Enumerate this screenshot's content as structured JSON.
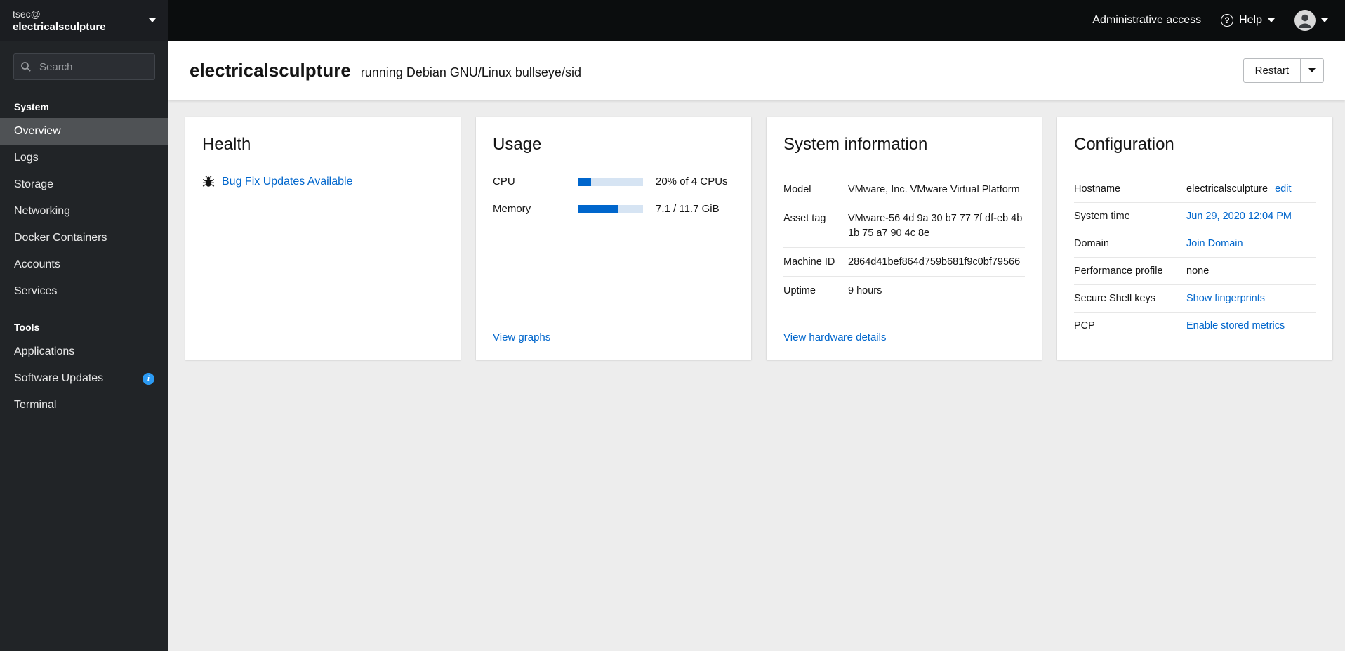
{
  "icons": {
    "help": "?",
    "info": "i"
  },
  "colors": {
    "accent": "#0066cc",
    "selected_nav": "#4f5255",
    "progress_track": "#d6e4f3",
    "info_badge": "#2b9af3"
  },
  "sidebar": {
    "host_user": "tsec@",
    "host_name": "electricalsculpture",
    "search_placeholder": "Search",
    "sections": [
      {
        "label": "System",
        "items": [
          {
            "label": "Overview"
          },
          {
            "label": "Logs"
          },
          {
            "label": "Storage"
          },
          {
            "label": "Networking"
          },
          {
            "label": "Docker Containers"
          },
          {
            "label": "Accounts"
          },
          {
            "label": "Services"
          }
        ]
      },
      {
        "label": "Tools",
        "items": [
          {
            "label": "Applications"
          },
          {
            "label": "Software Updates"
          },
          {
            "label": "Terminal"
          }
        ]
      }
    ]
  },
  "topbar": {
    "admin_access": "Administrative access",
    "help": "Help"
  },
  "header": {
    "hostname": "electricalsculpture",
    "os": "running Debian GNU/Linux bullseye/sid",
    "restart_label": "Restart"
  },
  "cards": {
    "health": {
      "title": "Health",
      "update_link": "Bug Fix Updates Available"
    },
    "usage": {
      "title": "Usage",
      "rows": [
        {
          "label": "CPU",
          "percent": 20,
          "value": "20% of 4 CPUs"
        },
        {
          "label": "Memory",
          "percent": 61,
          "value": "7.1 / 11.7 GiB"
        }
      ],
      "footer_link": "View graphs"
    },
    "system_info": {
      "title": "System information",
      "rows": [
        {
          "label": "Model",
          "value": "VMware, Inc. VMware Virtual Platform"
        },
        {
          "label": "Asset tag",
          "value": "VMware-56 4d 9a 30 b7 77 7f df-eb 4b 1b 75 a7 90 4c 8e"
        },
        {
          "label": "Machine ID",
          "value": "2864d41bef864d759b681f9c0bf79566"
        },
        {
          "label": "Uptime",
          "value": "9 hours"
        }
      ],
      "footer_link": "View hardware details"
    },
    "configuration": {
      "title": "Configuration",
      "rows": [
        {
          "label": "Hostname",
          "value": "electricalsculpture",
          "link": "edit"
        },
        {
          "label": "System time",
          "link": "Jun 29, 2020 12:04 PM"
        },
        {
          "label": "Domain",
          "link": "Join Domain"
        },
        {
          "label": "Performance profile",
          "value": "none"
        },
        {
          "label": "Secure Shell keys",
          "link": "Show fingerprints"
        },
        {
          "label": "PCP",
          "link": "Enable stored metrics"
        }
      ]
    }
  }
}
